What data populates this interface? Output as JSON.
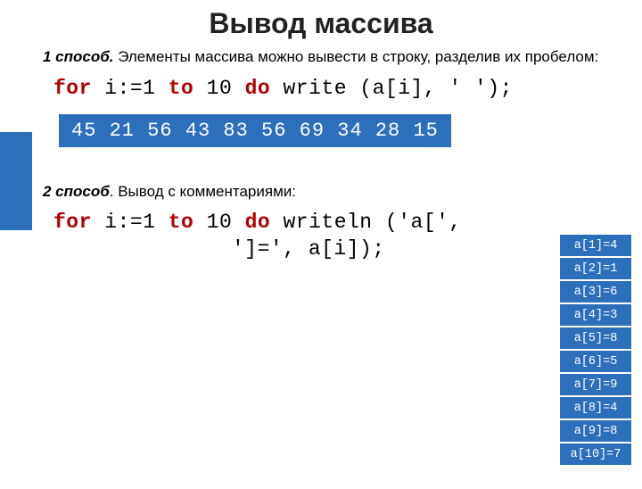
{
  "title": "Вывод массива",
  "desc1_bold": "1 способ.",
  "desc1_rest": " Элементы массива можно вывести в строку, разделив их пробелом:",
  "code1": {
    "kw_for": "for",
    "seg1": " i:=1 ",
    "kw_to": "to",
    "seg2": " 10 ",
    "kw_do": "do",
    "seg3": " write (a[i], ' ');"
  },
  "output_row": "45 21 56 43 83 56 69 34 28 15",
  "desc2_bold": "2 способ",
  "desc2_rest": ". Вывод с комментариями:",
  "code2": {
    "kw_for": "for",
    "seg1": " i:=1 ",
    "kw_to": "to",
    "seg2": " 10 ",
    "kw_do": "do",
    "seg3": " writeln ('a[',",
    "line2": "']=', a[i]);"
  },
  "side": [
    "a[1]=4",
    "a[2]=1",
    "a[3]=6",
    "a[4]=3",
    "a[5]=8",
    "a[6]=5",
    "a[7]=9",
    "a[8]=4",
    "a[9]=8",
    "a[10]=7"
  ]
}
